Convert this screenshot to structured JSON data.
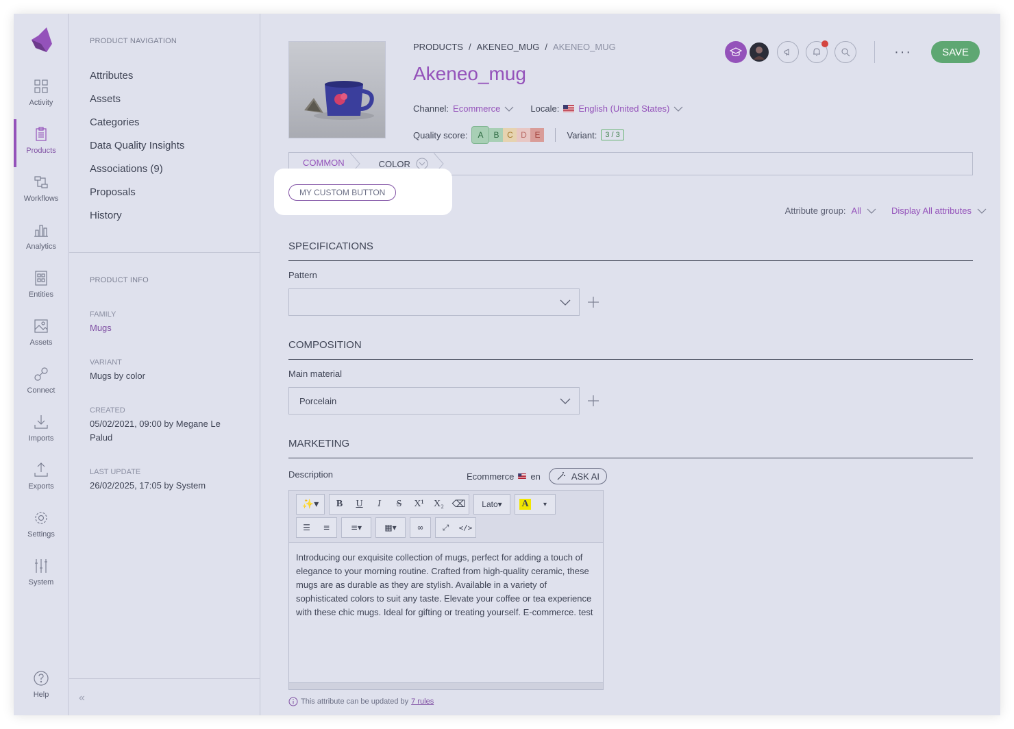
{
  "main_nav": {
    "items": [
      {
        "label": "Activity",
        "icon": "activity-icon"
      },
      {
        "label": "Products",
        "icon": "products-icon",
        "active": true
      },
      {
        "label": "Workflows",
        "icon": "workflows-icon"
      },
      {
        "label": "Analytics",
        "icon": "analytics-icon"
      },
      {
        "label": "Entities",
        "icon": "entities-icon"
      },
      {
        "label": "Assets",
        "icon": "assets-icon"
      },
      {
        "label": "Connect",
        "icon": "connect-icon"
      },
      {
        "label": "Imports",
        "icon": "imports-icon"
      },
      {
        "label": "Exports",
        "icon": "exports-icon"
      },
      {
        "label": "Settings",
        "icon": "settings-icon"
      },
      {
        "label": "System",
        "icon": "system-icon"
      }
    ],
    "help": "Help"
  },
  "column": {
    "nav_title": "PRODUCT NAVIGATION",
    "links": [
      "Attributes",
      "Assets",
      "Categories",
      "Data Quality Insights",
      "Associations (9)",
      "Proposals",
      "History"
    ],
    "info_title": "PRODUCT INFO",
    "info": [
      {
        "label": "FAMILY",
        "value": "Mugs"
      },
      {
        "label": "VARIANT",
        "value": "Mugs by color"
      },
      {
        "label": "CREATED",
        "value": "05/02/2021, 09:00 by Megane Le Palud"
      },
      {
        "label": "LAST UPDATE",
        "value": "26/02/2025, 17:05 by System"
      }
    ]
  },
  "header": {
    "breadcrumb": [
      "PRODUCTS",
      "AKENEO_MUG",
      "AKENEO_MUG"
    ],
    "title": "Akeneo_mug",
    "channel_label": "Channel:",
    "channel_value": "Ecommerce",
    "locale_label": "Locale:",
    "locale_value": "English (United States)",
    "quality_label": "Quality score:",
    "quality_grades": [
      "A",
      "B",
      "C",
      "D",
      "E"
    ],
    "variant_label": "Variant:",
    "variant_value": "3 / 3",
    "save_label": "SAVE",
    "more_label": "···"
  },
  "tabs": {
    "common": "COMMON",
    "color": "COLOR"
  },
  "custom_button": "MY CUSTOM BUTTON",
  "filters": {
    "group_label": "Attribute group:",
    "group_value": "All",
    "display_value": "Display All attributes"
  },
  "sections": [
    {
      "title": "SPECIFICATIONS",
      "field_label": "Pattern",
      "field_value": ""
    },
    {
      "title": "COMPOSITION",
      "field_label": "Main material",
      "field_value": "Porcelain"
    },
    {
      "title": "MARKETING",
      "field_label": "Description"
    }
  ],
  "description": {
    "scope": "Ecommerce",
    "locale": "en",
    "ask_ai": "ASK AI",
    "font_select": "Lato",
    "text": "Introducing our exquisite collection of mugs, perfect for adding a touch of elegance to your morning routine. Crafted from high-quality ceramic, these mugs are as durable as they are stylish. Available in a variety of sophisticated colors to suit any taste. Elevate your coffee or tea experience with these chic mugs. Ideal for gifting or treating yourself. E-commerce. test",
    "rules_text": "This attribute can be updated by",
    "rules_link": "7 rules"
  },
  "colors": {
    "accent": "#9452ba",
    "save": "#5ea772",
    "background": "#dfe1ed"
  }
}
